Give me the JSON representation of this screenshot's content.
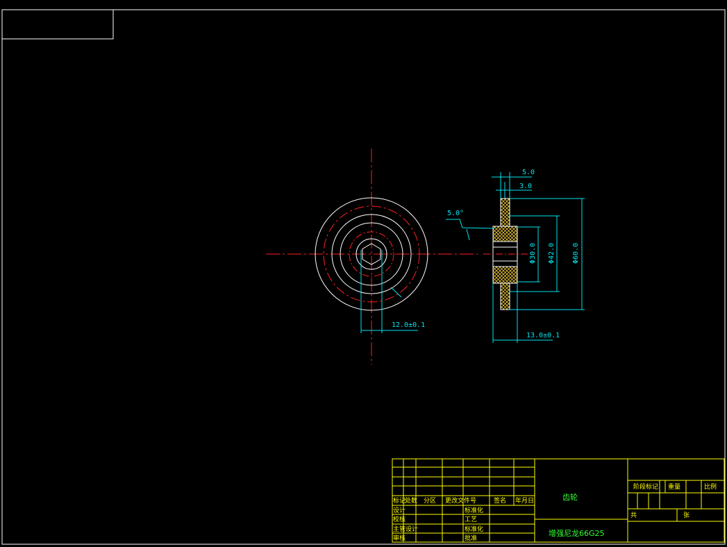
{
  "colors": {
    "background": "#000000",
    "border": "#ffffff",
    "outline": "#ffffff",
    "center_line": "#ff2020",
    "dimension": "#00e5ee",
    "hatch": "#e6c23a",
    "title_block_lines": "#ffff00",
    "title_block_text": "#ffff00",
    "title_block_green": "#33ff33"
  },
  "dimensions": {
    "width_outer": "5.0",
    "width_inner": "3.0",
    "chamfer": "5.0°",
    "hole_across_flats": "12.0±0.1",
    "bore_dia": "Φ30.0",
    "pitch_dia": "Φ42.0",
    "outer_dia": "Φ60.0",
    "total_width": "13.0±0.1"
  },
  "title_block": {
    "part_name": "齿轮",
    "material": "增强尼龙66G25",
    "row_labels": [
      "标记",
      "设计",
      "校核",
      "主管设计",
      "审核"
    ],
    "col_labels": [
      "处数",
      "分区",
      "更改文件号",
      "签名",
      "年月日"
    ],
    "process_labels": [
      "标准化",
      "工艺",
      "标准化",
      "批准"
    ],
    "right_labels": [
      "阶段标记",
      "重量",
      "比例"
    ],
    "sheet_labels": [
      "共",
      "张"
    ]
  }
}
